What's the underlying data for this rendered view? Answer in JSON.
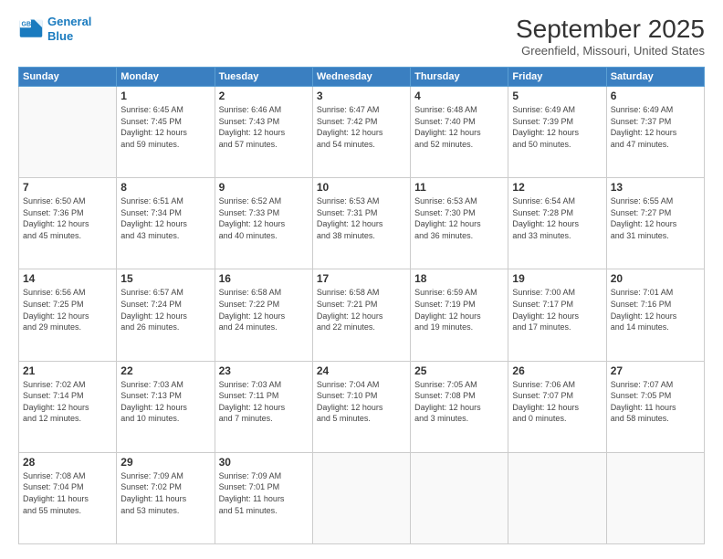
{
  "header": {
    "logo_line1": "General",
    "logo_line2": "Blue",
    "month": "September 2025",
    "location": "Greenfield, Missouri, United States"
  },
  "weekdays": [
    "Sunday",
    "Monday",
    "Tuesday",
    "Wednesday",
    "Thursday",
    "Friday",
    "Saturday"
  ],
  "weeks": [
    [
      {
        "day": "",
        "info": ""
      },
      {
        "day": "1",
        "info": "Sunrise: 6:45 AM\nSunset: 7:45 PM\nDaylight: 12 hours\nand 59 minutes."
      },
      {
        "day": "2",
        "info": "Sunrise: 6:46 AM\nSunset: 7:43 PM\nDaylight: 12 hours\nand 57 minutes."
      },
      {
        "day": "3",
        "info": "Sunrise: 6:47 AM\nSunset: 7:42 PM\nDaylight: 12 hours\nand 54 minutes."
      },
      {
        "day": "4",
        "info": "Sunrise: 6:48 AM\nSunset: 7:40 PM\nDaylight: 12 hours\nand 52 minutes."
      },
      {
        "day": "5",
        "info": "Sunrise: 6:49 AM\nSunset: 7:39 PM\nDaylight: 12 hours\nand 50 minutes."
      },
      {
        "day": "6",
        "info": "Sunrise: 6:49 AM\nSunset: 7:37 PM\nDaylight: 12 hours\nand 47 minutes."
      }
    ],
    [
      {
        "day": "7",
        "info": "Sunrise: 6:50 AM\nSunset: 7:36 PM\nDaylight: 12 hours\nand 45 minutes."
      },
      {
        "day": "8",
        "info": "Sunrise: 6:51 AM\nSunset: 7:34 PM\nDaylight: 12 hours\nand 43 minutes."
      },
      {
        "day": "9",
        "info": "Sunrise: 6:52 AM\nSunset: 7:33 PM\nDaylight: 12 hours\nand 40 minutes."
      },
      {
        "day": "10",
        "info": "Sunrise: 6:53 AM\nSunset: 7:31 PM\nDaylight: 12 hours\nand 38 minutes."
      },
      {
        "day": "11",
        "info": "Sunrise: 6:53 AM\nSunset: 7:30 PM\nDaylight: 12 hours\nand 36 minutes."
      },
      {
        "day": "12",
        "info": "Sunrise: 6:54 AM\nSunset: 7:28 PM\nDaylight: 12 hours\nand 33 minutes."
      },
      {
        "day": "13",
        "info": "Sunrise: 6:55 AM\nSunset: 7:27 PM\nDaylight: 12 hours\nand 31 minutes."
      }
    ],
    [
      {
        "day": "14",
        "info": "Sunrise: 6:56 AM\nSunset: 7:25 PM\nDaylight: 12 hours\nand 29 minutes."
      },
      {
        "day": "15",
        "info": "Sunrise: 6:57 AM\nSunset: 7:24 PM\nDaylight: 12 hours\nand 26 minutes."
      },
      {
        "day": "16",
        "info": "Sunrise: 6:58 AM\nSunset: 7:22 PM\nDaylight: 12 hours\nand 24 minutes."
      },
      {
        "day": "17",
        "info": "Sunrise: 6:58 AM\nSunset: 7:21 PM\nDaylight: 12 hours\nand 22 minutes."
      },
      {
        "day": "18",
        "info": "Sunrise: 6:59 AM\nSunset: 7:19 PM\nDaylight: 12 hours\nand 19 minutes."
      },
      {
        "day": "19",
        "info": "Sunrise: 7:00 AM\nSunset: 7:17 PM\nDaylight: 12 hours\nand 17 minutes."
      },
      {
        "day": "20",
        "info": "Sunrise: 7:01 AM\nSunset: 7:16 PM\nDaylight: 12 hours\nand 14 minutes."
      }
    ],
    [
      {
        "day": "21",
        "info": "Sunrise: 7:02 AM\nSunset: 7:14 PM\nDaylight: 12 hours\nand 12 minutes."
      },
      {
        "day": "22",
        "info": "Sunrise: 7:03 AM\nSunset: 7:13 PM\nDaylight: 12 hours\nand 10 minutes."
      },
      {
        "day": "23",
        "info": "Sunrise: 7:03 AM\nSunset: 7:11 PM\nDaylight: 12 hours\nand 7 minutes."
      },
      {
        "day": "24",
        "info": "Sunrise: 7:04 AM\nSunset: 7:10 PM\nDaylight: 12 hours\nand 5 minutes."
      },
      {
        "day": "25",
        "info": "Sunrise: 7:05 AM\nSunset: 7:08 PM\nDaylight: 12 hours\nand 3 minutes."
      },
      {
        "day": "26",
        "info": "Sunrise: 7:06 AM\nSunset: 7:07 PM\nDaylight: 12 hours\nand 0 minutes."
      },
      {
        "day": "27",
        "info": "Sunrise: 7:07 AM\nSunset: 7:05 PM\nDaylight: 11 hours\nand 58 minutes."
      }
    ],
    [
      {
        "day": "28",
        "info": "Sunrise: 7:08 AM\nSunset: 7:04 PM\nDaylight: 11 hours\nand 55 minutes."
      },
      {
        "day": "29",
        "info": "Sunrise: 7:09 AM\nSunset: 7:02 PM\nDaylight: 11 hours\nand 53 minutes."
      },
      {
        "day": "30",
        "info": "Sunrise: 7:09 AM\nSunset: 7:01 PM\nDaylight: 11 hours\nand 51 minutes."
      },
      {
        "day": "",
        "info": ""
      },
      {
        "day": "",
        "info": ""
      },
      {
        "day": "",
        "info": ""
      },
      {
        "day": "",
        "info": ""
      }
    ]
  ]
}
